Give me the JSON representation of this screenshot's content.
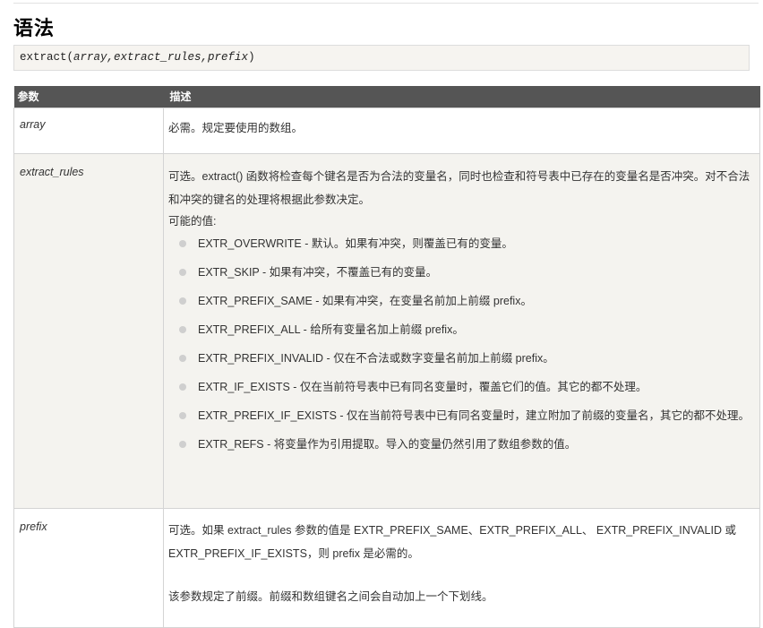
{
  "section_title": "语法",
  "syntax": {
    "function": "extract(",
    "params": "array,extract_rules,prefix",
    "close": ")"
  },
  "table": {
    "headers": {
      "param": "参数",
      "desc": "描述"
    },
    "rows": [
      {
        "param": "array",
        "desc": "必需。规定要使用的数组。"
      },
      {
        "param": "extract_rules",
        "desc_line1": "可选。extract() 函数将检查每个键名是否为合法的变量名，同时也检查和符号表中已存在的变量名是否冲突。对不合法和冲突的键名的处理将根据此参数决定。",
        "desc_line2": "可能的值:",
        "options": [
          "EXTR_OVERWRITE - 默认。如果有冲突，则覆盖已有的变量。",
          "EXTR_SKIP - 如果有冲突，不覆盖已有的变量。",
          "EXTR_PREFIX_SAME - 如果有冲突，在变量名前加上前缀 prefix。",
          "EXTR_PREFIX_ALL - 给所有变量名加上前缀 prefix。",
          "EXTR_PREFIX_INVALID - 仅在不合法或数字变量名前加上前缀 prefix。",
          "EXTR_IF_EXISTS - 仅在当前符号表中已有同名变量时，覆盖它们的值。其它的都不处理。",
          "EXTR_PREFIX_IF_EXISTS - 仅在当前符号表中已有同名变量时，建立附加了前缀的变量名，其它的都不处理。",
          "EXTR_REFS - 将变量作为引用提取。导入的变量仍然引用了数组参数的值。"
        ]
      },
      {
        "param": "prefix",
        "desc_line1": "可选。如果 extract_rules 参数的值是 EXTR_PREFIX_SAME、EXTR_PREFIX_ALL、 EXTR_PREFIX_INVALID 或 EXTR_PREFIX_IF_EXISTS，则 prefix 是必需的。",
        "desc_line2": "该参数规定了前缀。前缀和数组键名之间会自动加上一个下划线。"
      }
    ]
  },
  "colors": {
    "header_bg": "#555555",
    "alt_row_bg": "#f4f3ef",
    "code_bg": "#f6f4f0",
    "bullet": "#cfcfcf"
  }
}
